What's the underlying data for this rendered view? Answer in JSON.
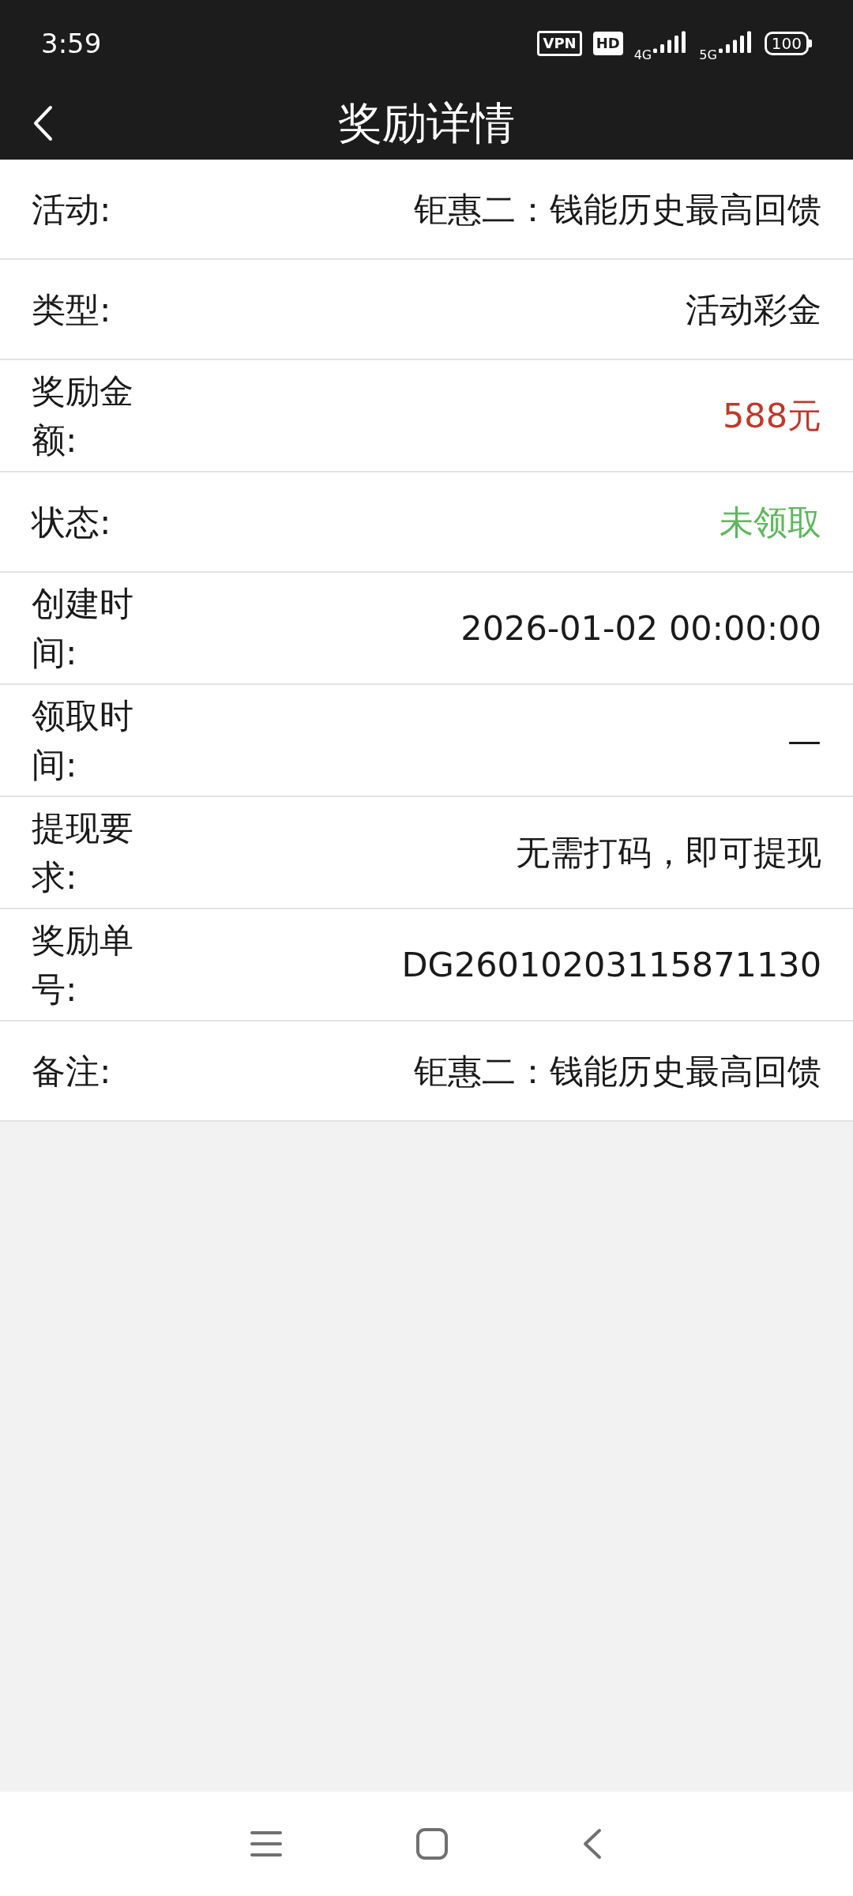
{
  "status_bar": {
    "time": "3:59",
    "vpn": "VPN",
    "hd": "HD",
    "network_1": "4G",
    "network_2": "5G",
    "battery": "100"
  },
  "header": {
    "title": "奖励详情"
  },
  "rows": [
    {
      "label": "活动:",
      "value": "钜惠二：钱能历史最高回馈",
      "color": "#1a1a1a"
    },
    {
      "label": "类型:",
      "value": "活动彩金",
      "color": "#1a1a1a"
    },
    {
      "label": "奖励金额:",
      "value": "588元",
      "color": "#c0392b"
    },
    {
      "label": "状态:",
      "value": "未领取",
      "color": "#5cb85c"
    },
    {
      "label": "创建时间:",
      "value": "2026-01-02 00:00:00",
      "color": "#1a1a1a"
    },
    {
      "label": "领取时间:",
      "value": "—",
      "color": "#1a1a1a"
    },
    {
      "label": "提现要求:",
      "value": "无需打码，即可提现",
      "color": "#1a1a1a"
    },
    {
      "label": "奖励单号:",
      "value": "DG26010203115871130",
      "color": "#1a1a1a"
    },
    {
      "label": "备注:",
      "value": "钜惠二：钱能历史最高回馈",
      "color": "#1a1a1a"
    }
  ]
}
